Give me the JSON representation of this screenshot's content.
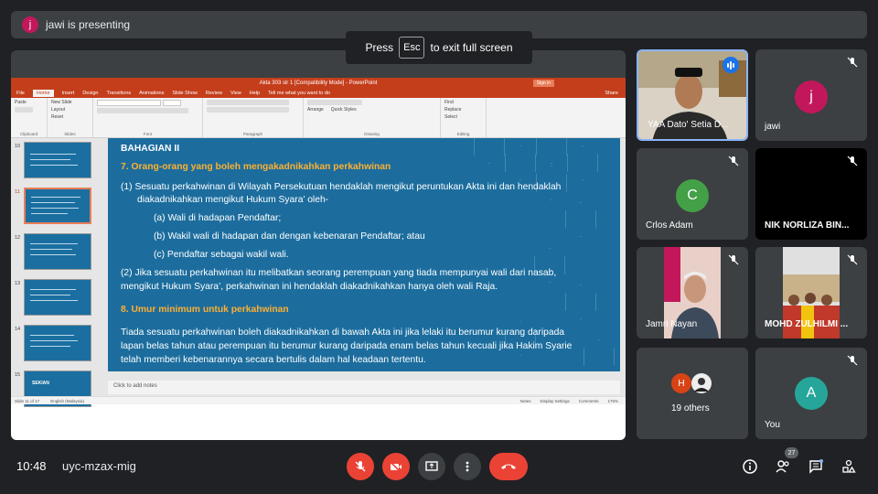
{
  "presenter": {
    "initial": "j",
    "text": "jawi is presenting"
  },
  "toast": {
    "press": "Press",
    "key": "Esc",
    "rest": "to exit full screen"
  },
  "ppt": {
    "title": "Akta 303 slr 1 [Compatibility Mode] - PowerPoint",
    "sign_in": "Sign in",
    "tabs": [
      "File",
      "Home",
      "Insert",
      "Design",
      "Transitions",
      "Animations",
      "Slide Show",
      "Review",
      "View",
      "Help",
      "Tell me what you want to do",
      "Share"
    ],
    "groups": [
      "Clipboard",
      "Slides",
      "Font",
      "Paragraph",
      "Drawing",
      "Editing"
    ],
    "ribbon": {
      "paste": "Paste",
      "new_slide": "New Slide",
      "layout": "Layout",
      "reset": "Reset",
      "section": "Section",
      "arrange": "Arrange",
      "quick_styles": "Quick Styles",
      "find": "Find",
      "replace": "Replace",
      "select": "Select"
    },
    "thumb_numbers": [
      "10",
      "11",
      "12",
      "13",
      "14",
      "15"
    ],
    "thumb_last_text": "SEKIAN",
    "notes": "Click to add notes",
    "status_left": "Slide 11 of 17",
    "status_lang": "English (Malaysia)",
    "status_right": [
      "Notes",
      "Display Settings",
      "Comments",
      "175%"
    ]
  },
  "slide": {
    "heading": "BAHAGIAN II",
    "section7": "7. Orang-orang yang boleh mengakadnikahkan perkahwinan",
    "p1a": "(1)  Sesuatu perkahwinan di Wilayah Persekutuan hendaklah mengikut peruntukan Akta ini dan hendaklah",
    "p1b": "diakadnikahkan mengikut Hukum Syara’ oleh-",
    "a": "(a)  Wali di hadapan Pendaftar;",
    "b": "(b)  Wakil wali di hadapan dan dengan kebenaran Pendaftar; atau",
    "c": "(c)  Pendaftar sebagai wakil wali.",
    "p2a": "(2) Jika sesuatu perkahwinan itu melibatkan seorang perempuan yang tiada mempunyai wali dari nasab,",
    "p2b": "mengikut Hukum Syara’, perkahwinan ini hendaklah diakadnikahkan hanya oleh wali Raja.",
    "section8": "8. Umur minimum untuk perkahwinan",
    "p3a": "Tiada sesuatu perkahwinan boleh diakadnikahkan di bawah Akta ini jika lelaki itu berumur kurang daripada",
    "p3b": "lapan belas tahun atau perempuan itu berumur kurang daripada enam belas tahun kecuali jika Hakim Syarie",
    "p3c": "telah memberi kebenarannya secara bertulis dalam hal keadaan tertentu."
  },
  "participants": [
    {
      "name": "YAA Dato' Setia D...",
      "kind": "video"
    },
    {
      "name": "jawi",
      "initial": "j",
      "color": "#c2185b"
    },
    {
      "name": "Crlos Adam",
      "initial": "C",
      "color": "#43a047"
    },
    {
      "name": "NIK NORLIZA BIN...",
      "kind": "black"
    },
    {
      "name": "Jamri Nayan",
      "kind": "video"
    },
    {
      "name": "MOHD ZULHILMI ...",
      "kind": "video"
    },
    {
      "name": "19 others",
      "initial": "H",
      "color": "#d84315"
    },
    {
      "name": "You",
      "initial": "A",
      "color": "#26a69a"
    }
  ],
  "bottom": {
    "time": "10:48",
    "code": "uyc-mzax-mig",
    "people_count": "27"
  }
}
